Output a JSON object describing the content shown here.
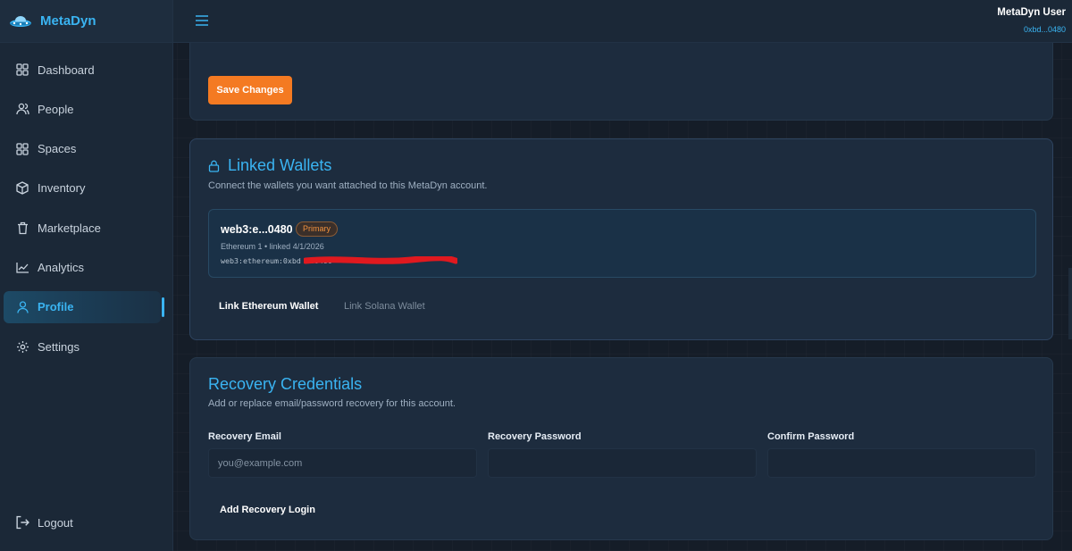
{
  "app": {
    "name": "MetaDyn"
  },
  "sidebar": {
    "items": [
      {
        "label": "Dashboard",
        "icon": "grid-icon"
      },
      {
        "label": "People",
        "icon": "people-icon"
      },
      {
        "label": "Spaces",
        "icon": "grid-icon"
      },
      {
        "label": "Inventory",
        "icon": "box-icon"
      },
      {
        "label": "Marketplace",
        "icon": "trash-icon"
      },
      {
        "label": "Analytics",
        "icon": "chart-icon"
      },
      {
        "label": "Profile",
        "icon": "user-icon",
        "active": true
      },
      {
        "label": "Settings",
        "icon": "gear-icon"
      }
    ],
    "logout_label": "Logout"
  },
  "header": {
    "user_name": "MetaDyn User",
    "user_address": "0xbd...0480"
  },
  "profile_card": {
    "save_label": "Save Changes"
  },
  "wallets": {
    "title": "Linked Wallets",
    "subtitle": "Connect the wallets you want attached to this MetaDyn account.",
    "items": [
      {
        "id": "web3:e...0480",
        "badge": "Primary",
        "meta": "Ethereum 1 • linked 4/1/2026",
        "full": "web3:ethereum:0xbd                            a80480"
      }
    ],
    "link_eth_label": "Link Ethereum Wallet",
    "link_sol_label": "Link Solana Wallet"
  },
  "recovery": {
    "title": "Recovery Credentials",
    "subtitle": "Add or replace email/password recovery for this account.",
    "email_label": "Recovery Email",
    "email_placeholder": "you@example.com",
    "password_label": "Recovery Password",
    "confirm_label": "Confirm Password",
    "add_label": "Add Recovery Login"
  },
  "colors": {
    "accent": "#3ab4f2",
    "primary_button": "#f47a22",
    "background": "#151d28",
    "card": "#1d2c3e",
    "redaction": "#e0191f"
  }
}
